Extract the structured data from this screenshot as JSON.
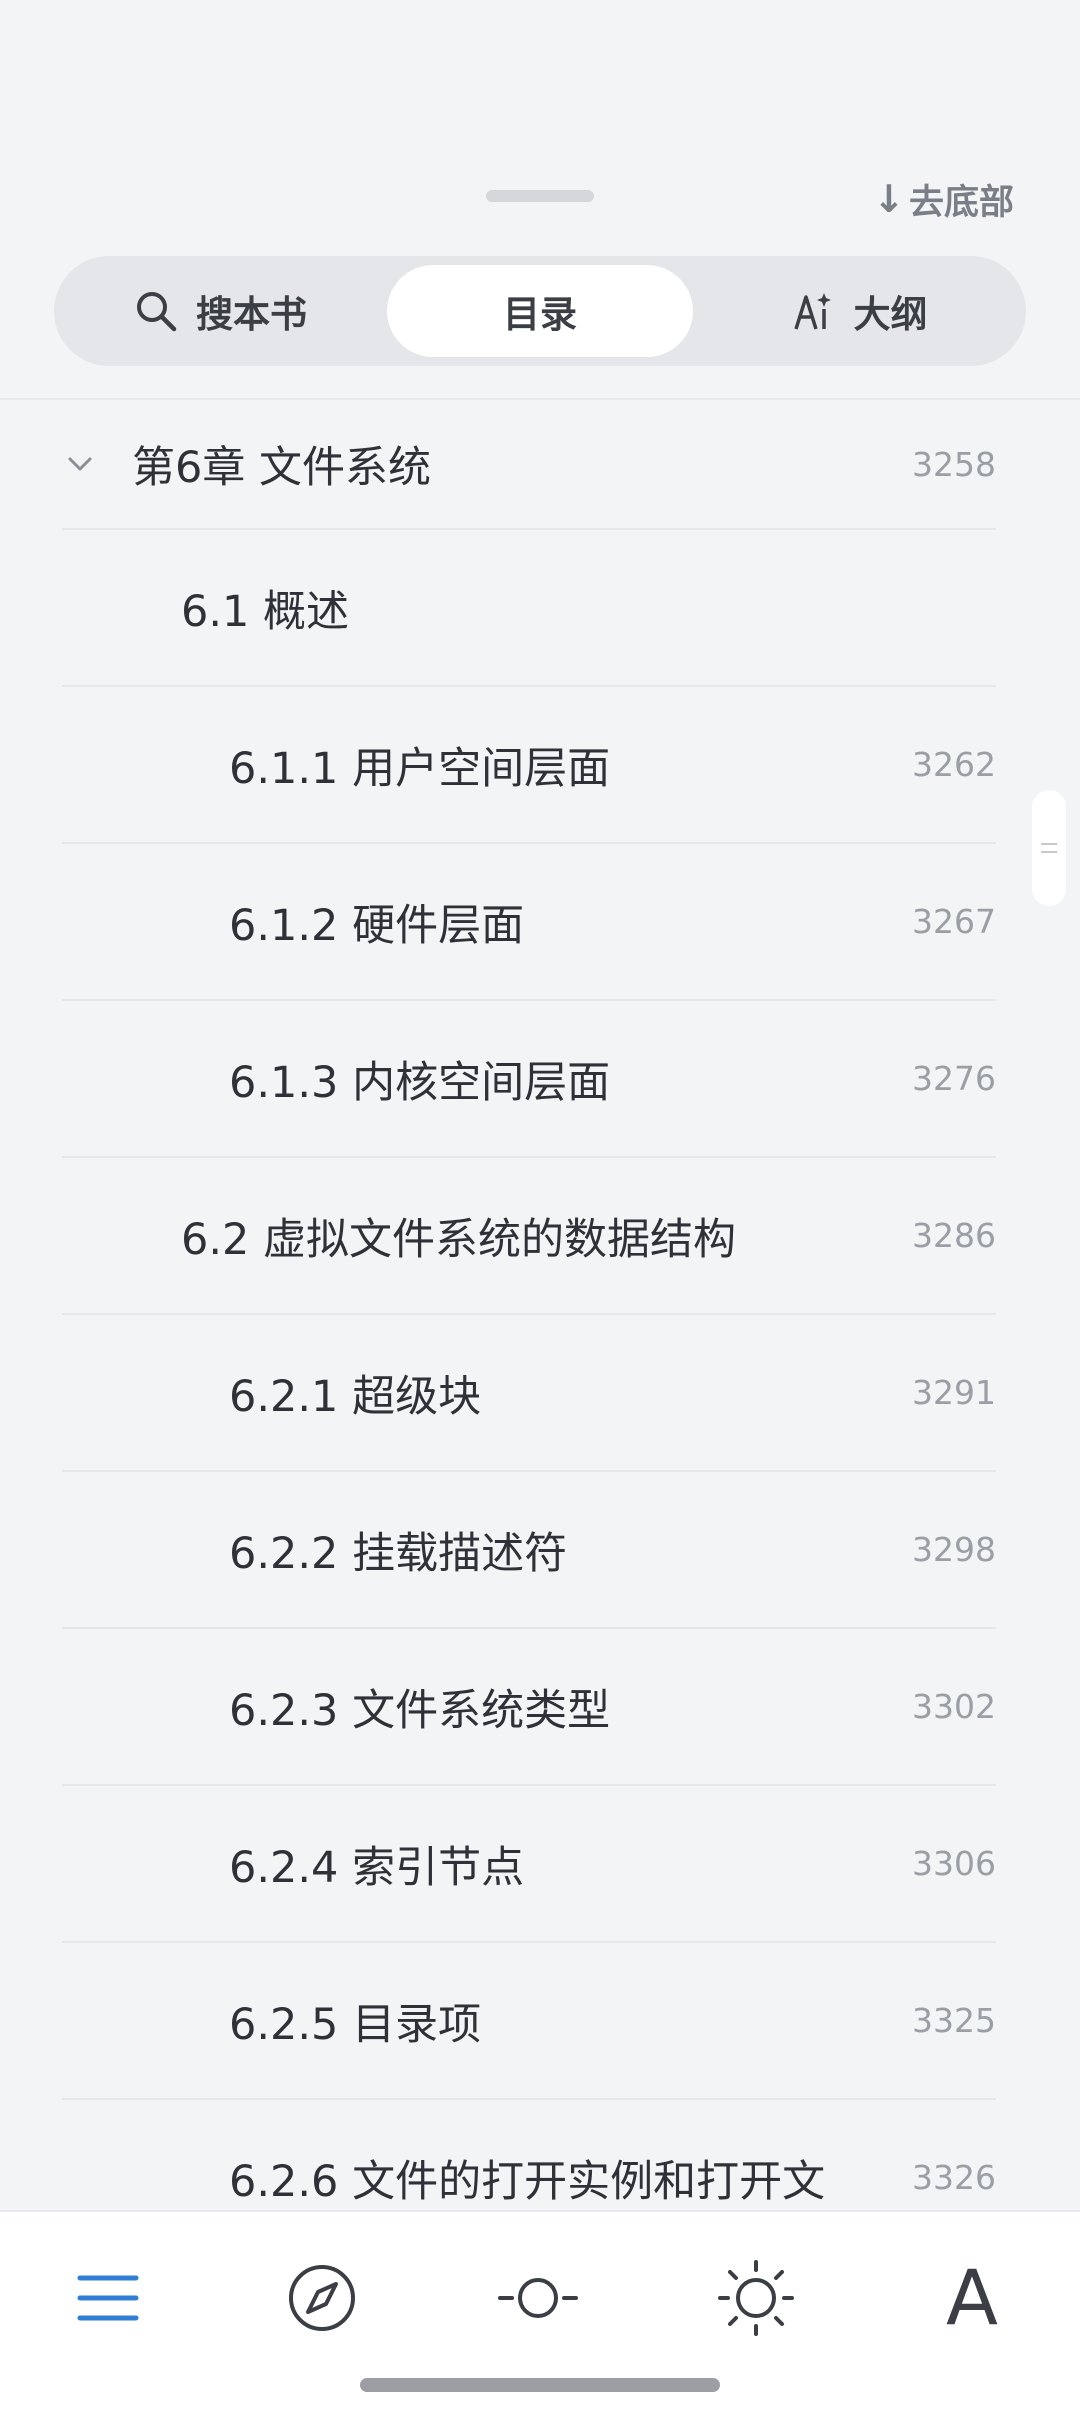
{
  "header": {
    "go_bottom_label": "去底部",
    "go_bottom_arrow": "↓"
  },
  "segment": {
    "search_label": "搜本书",
    "toc_label": "目录",
    "outline_label": "大纲",
    "active": "toc"
  },
  "toc": {
    "items": [
      {
        "title": "第6章 文件系统",
        "page": "3258",
        "level": 1
      },
      {
        "title": "6.1 概述",
        "page": "",
        "level": 2
      },
      {
        "title": "6.1.1 用户空间层面",
        "page": "3262",
        "level": 3
      },
      {
        "title": "6.1.2 硬件层面",
        "page": "3267",
        "level": 3
      },
      {
        "title": "6.1.3 内核空间层面",
        "page": "3276",
        "level": 3
      },
      {
        "title": "6.2 虚拟文件系统的数据结构",
        "page": "3286",
        "level": 2
      },
      {
        "title": "6.2.1 超级块",
        "page": "3291",
        "level": 3
      },
      {
        "title": "6.2.2 挂载描述符",
        "page": "3298",
        "level": 3
      },
      {
        "title": "6.2.3 文件系统类型",
        "page": "3302",
        "level": 3
      },
      {
        "title": "6.2.4 索引节点",
        "page": "3306",
        "level": 3
      },
      {
        "title": "6.2.5 目录项",
        "page": "3325",
        "level": 3
      },
      {
        "title": "6.2.6 文件的打开实例和打开文",
        "page": "3326",
        "level": 3
      }
    ]
  },
  "toolbar": {
    "font_label": "A",
    "icons": [
      "menu-icon",
      "compass-icon",
      "progress-icon",
      "brightness-icon",
      "font-icon"
    ],
    "active_color": "#2f7fd6"
  }
}
